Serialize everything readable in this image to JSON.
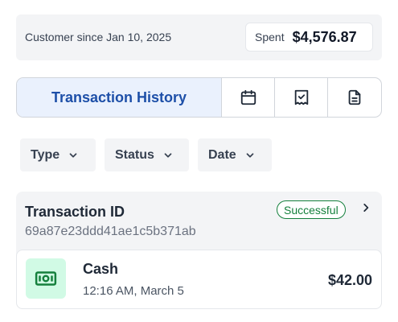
{
  "header": {
    "customer_since": "Customer since Jan 10, 2025",
    "spent_label": "Spent",
    "spent_value": "$4,576.87"
  },
  "tabs": {
    "active_label": "Transaction History",
    "icons": [
      "calendar-icon",
      "receipt-check-icon",
      "document-icon"
    ]
  },
  "filters": [
    {
      "label": "Type"
    },
    {
      "label": "Status"
    },
    {
      "label": "Date"
    }
  ],
  "transaction": {
    "title": "Transaction ID",
    "id": "69a87e23ddd41ae1c5b371ab",
    "status": "Successful",
    "payment": {
      "method": "Cash",
      "time": "12:16 AM, March 5",
      "amount": "$42.00",
      "icon": "cash-icon"
    }
  },
  "colors": {
    "accent": "#1d4fa8",
    "active_tab_bg": "#eaf1fd",
    "success": "#15803d",
    "cash_icon_bg": "#d1fae5"
  }
}
